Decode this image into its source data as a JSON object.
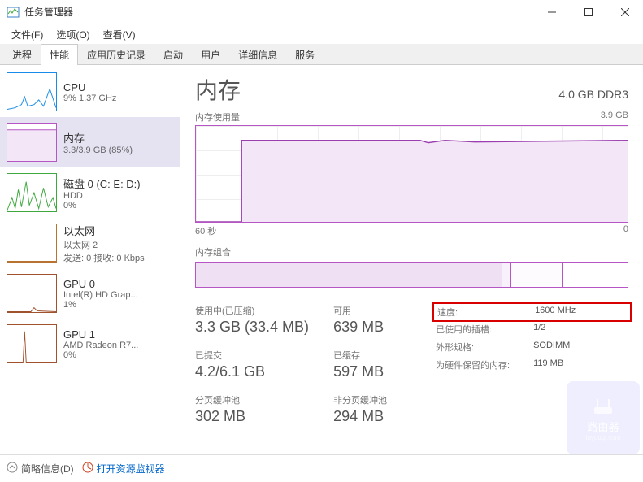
{
  "window": {
    "title": "任务管理器"
  },
  "menu": {
    "file": "文件(F)",
    "options": "选项(O)",
    "view": "查看(V)"
  },
  "tabs": [
    "进程",
    "性能",
    "应用历史记录",
    "启动",
    "用户",
    "详细信息",
    "服务"
  ],
  "active_tab": 1,
  "sidebar": [
    {
      "key": "cpu",
      "name": "CPU",
      "detail": "9%  1.37 GHz"
    },
    {
      "key": "mem",
      "name": "内存",
      "detail": "3.3/3.9 GB (85%)"
    },
    {
      "key": "disk",
      "name": "磁盘 0 (C: E: D:)",
      "detail": "HDD",
      "detail2": "0%"
    },
    {
      "key": "eth",
      "name": "以太网",
      "detail": "以太网 2",
      "detail2": "发送: 0  接收: 0 Kbps"
    },
    {
      "key": "gpu0",
      "name": "GPU 0",
      "detail": "Intel(R) HD Grap...",
      "detail2": "1%"
    },
    {
      "key": "gpu1",
      "name": "GPU 1",
      "detail": "AMD Radeon R7...",
      "detail2": "0%"
    }
  ],
  "sidebar_selected": 1,
  "main": {
    "title": "内存",
    "capacity": "4.0 GB DDR3",
    "usage_label": "内存使用量",
    "usage_max": "3.9 GB",
    "x_left": "60 秒",
    "x_right": "0",
    "composition_label": "内存组合",
    "stats": {
      "inuse_label": "使用中(已压缩)",
      "inuse_value": "3.3 GB (33.4 MB)",
      "committed_label": "已提交",
      "committed_value": "4.2/6.1 GB",
      "paged_label": "分页缓冲池",
      "paged_value": "302 MB",
      "avail_label": "可用",
      "avail_value": "639 MB",
      "cached_label": "已缓存",
      "cached_value": "597 MB",
      "nonpaged_label": "非分页缓冲池",
      "nonpaged_value": "294 MB"
    },
    "info": {
      "speed_label": "速度:",
      "speed_value": "1600 MHz",
      "slots_label": "已使用的插槽:",
      "slots_value": "1/2",
      "form_label": "外形规格:",
      "form_value": "SODIMM",
      "reserved_label": "为硬件保留的内存:",
      "reserved_value": "119 MB"
    }
  },
  "footer": {
    "brief": "简略信息(D)",
    "resmon": "打开资源监视器"
  },
  "watermark": {
    "name": "路由器",
    "url": "luyouqi.com"
  },
  "chart_data": {
    "type": "line",
    "title": "内存使用量",
    "ylabel": "GB",
    "ylim": [
      0,
      3.9
    ],
    "xlabel": "秒",
    "xlim": [
      60,
      0
    ],
    "series": [
      {
        "name": "内存",
        "values_gb_from_60s_to_0s": [
          0,
          0,
          0,
          0,
          0,
          0,
          0,
          3.3,
          3.3,
          3.3,
          3.3,
          3.3,
          3.3,
          3.3,
          3.3,
          3.3,
          3.3,
          3.3,
          3.3,
          3.3,
          3.3,
          3.3,
          3.3,
          3.3,
          3.3,
          3.3,
          3.3,
          3.3,
          3.3,
          3.3,
          3.3,
          3.3,
          3.25,
          3.3,
          3.3,
          3.3,
          3.3,
          3.3,
          3.28,
          3.3,
          3.3,
          3.3,
          3.3,
          3.3,
          3.3,
          3.3,
          3.3,
          3.3,
          3.3,
          3.3,
          3.3,
          3.3,
          3.3,
          3.3,
          3.3,
          3.3,
          3.3,
          3.3,
          3.3,
          3.3,
          3.3
        ]
      }
    ]
  }
}
